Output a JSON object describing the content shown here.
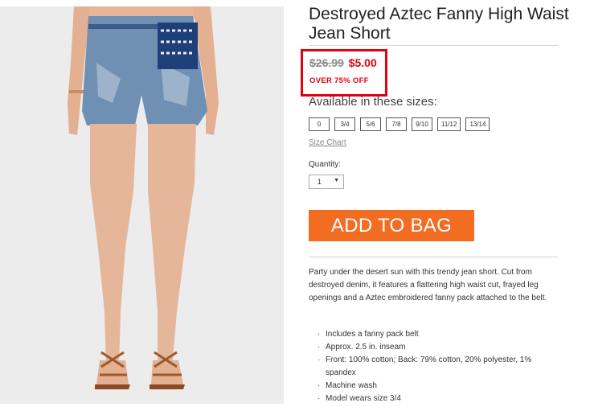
{
  "product": {
    "title": "Destroyed Aztec Fanny High Waist Jean Short",
    "image_alt": "model wearing destroyed denim high waist shorts with Aztec fanny pack and brown sandals"
  },
  "pricing": {
    "original_price": "$26.99",
    "sale_price": "$5.00",
    "discount_label": "OVER 75% OFF",
    "highlight_color": "#e3000f"
  },
  "sizes": {
    "heading": "Available in these sizes:",
    "options": [
      "0",
      "3/4",
      "5/6",
      "7/8",
      "9/10",
      "11/12",
      "13/14"
    ],
    "size_chart_link": "Size Chart"
  },
  "quantity": {
    "label": "Quantity:",
    "selected": "1"
  },
  "cta": {
    "label": "ADD TO BAG",
    "color": "#f26c22"
  },
  "description": {
    "text": "Party under the desert sun with this trendy jean short. Cut from destroyed denim, it features a flattering high waist cut, frayed leg openings and a Aztec embroidered fanny pack attached to the belt.",
    "features": [
      "Includes a fanny pack belt",
      "Approx. 2.5 in. inseam",
      "Front: 100% cotton; Back: 79% cotton, 20% polyester, 1% spandex",
      "Machine wash",
      "Model wears size 3/4"
    ]
  }
}
